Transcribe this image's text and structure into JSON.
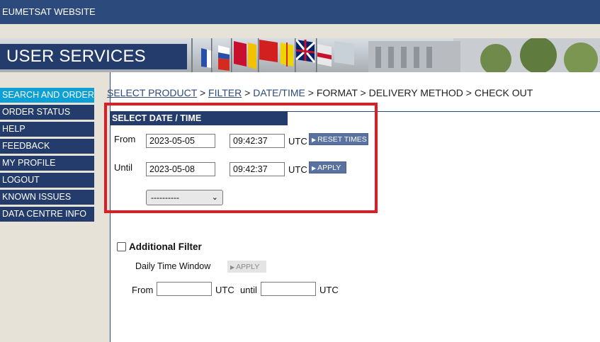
{
  "topbar": {
    "title": "EUMETSAT WEBSITE"
  },
  "banner": {
    "title": "USER SERVICES CLIENT"
  },
  "sidebar": {
    "items": [
      {
        "label": "SEARCH AND ORDER",
        "active": true
      },
      {
        "label": "ORDER STATUS"
      },
      {
        "label": "HELP"
      },
      {
        "label": "FEEDBACK"
      },
      {
        "label": "MY PROFILE"
      },
      {
        "label": "LOGOUT"
      },
      {
        "label": "KNOWN ISSUES"
      },
      {
        "label": "DATA CENTRE INFO"
      }
    ]
  },
  "breadcrumb": {
    "select_product": "SELECT PRODUCT",
    "filter": "FILTER",
    "date_time": "DATE/TIME",
    "format": "FORMAT",
    "delivery_method": "DELIVERY METHOD",
    "check_out": "CHECK OUT",
    "separator": ">"
  },
  "date_time": {
    "heading": "SELECT DATE / TIME",
    "from_label": "From",
    "until_label": "Until",
    "from_date": "2023-05-05",
    "from_time": "09:42:37",
    "until_date": "2023-05-08",
    "until_time": "09:42:37",
    "utc_label": "UTC",
    "reset_button": "RESET TIMES",
    "apply_button": "APPLY",
    "preset_select": "----------"
  },
  "additional_filter": {
    "label": "Additional Filter",
    "daily_window_label": "Daily Time Window",
    "apply_button": "APPLY",
    "from_label": "From",
    "utc_label": "UTC",
    "until_label": "until",
    "from_value": "",
    "until_value": ""
  },
  "colors": {
    "navy": "#233c6b",
    "active_nav": "#0da0d6",
    "highlight_box": "#e01b24",
    "background_beige": "#e6e2d8"
  }
}
